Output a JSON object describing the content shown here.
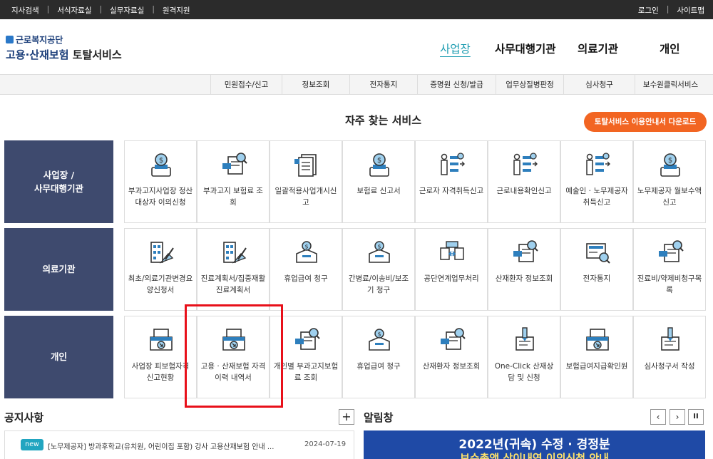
{
  "topbar": {
    "left": [
      "지사검색",
      "서식자료실",
      "실무자료실",
      "원격지원"
    ],
    "right": [
      "로그인",
      "사이트맵"
    ]
  },
  "logo": {
    "org": "근로복지공단",
    "title_blue": "고용·산재보험",
    "title_dark": "토탈서비스"
  },
  "main_nav": [
    "사업장",
    "사무대행기관",
    "의료기관",
    "개인"
  ],
  "sub_nav": [
    "민원접수/신고",
    "정보조회",
    "전자통지",
    "증명원 신청/발급",
    "업무상질병판정",
    "심사청구",
    "보수원클릭서비스"
  ],
  "section_title": "자주 찾는 서비스",
  "download_button": "토탈서비스 이용안내서 다운로드",
  "rows": [
    {
      "label": "사업장 /\n사무대행기관",
      "items": [
        "부과고지사업장 정산대상자 이의신청",
        "부과고지 보험료 조회",
        "일괄적용사업개시신고",
        "보험료 신고서",
        "근로자 자격취득신고",
        "근로내용확인신고",
        "예술인 · 노무제공자 취득신고",
        "노무제공자 월보수액 신고"
      ]
    },
    {
      "label": "의료기관",
      "items": [
        "최초/의료기관변경요양신청서",
        "진료계획서/집중재활진료계획서",
        "휴업급여 청구",
        "간병료/이송비/보조기 청구",
        "공단연계업무처리",
        "산재환자 정보조회",
        "전자통지",
        "진료비/약제비청구목록"
      ]
    },
    {
      "label": "개인",
      "items": [
        "사업장 피보험자격 신고현황",
        "고용 · 산재보험 자격 이력 내역서",
        "개인별 부과고지보험료 조회",
        "휴업급여 청구",
        "산재환자 정보조회",
        "One-Click 산재상담 및 신청",
        "보험급여지급확인원",
        "심사청구서 작성"
      ]
    }
  ],
  "notice": {
    "title": "공지사항",
    "plus": "+",
    "badge": "new",
    "text": "[노무제공자] 방과후학교(유치원, 어린이집 포함) 강사 고용산재보험 안내 ...",
    "date": "2024-07-19"
  },
  "alert": {
    "title": "알림창",
    "prev": "‹",
    "next": "›",
    "pause": "II",
    "banner_line1": "2022년(귀속) 수정 · 경정분",
    "banner_line2": "보수총액 상이내역 이의신청 안내"
  },
  "colors": {
    "row_label_bg": "#3e4a6e",
    "accent": "#1a9bb0",
    "button": "#f26522",
    "highlight": "#e8101a"
  },
  "icons": [
    [
      "monitor-coin-icon",
      "document-search-icon",
      "document-stack-icon",
      "monitor-coin-icon",
      "people-list-icon",
      "people-list-icon",
      "people-list-icon",
      "monitor-coin-icon"
    ],
    [
      "hospital-pen-icon",
      "hospital-pen-icon",
      "box-coin-icon",
      "box-coin-icon",
      "document-exchange-icon",
      "document-search-icon",
      "monitor-magnify-icon",
      "document-search-icon"
    ],
    [
      "tray-download-icon",
      "tray-download-icon",
      "document-search-icon",
      "box-coin-icon",
      "document-search-icon",
      "pen-document-icon",
      "tray-download-icon",
      "pen-document-icon"
    ]
  ]
}
